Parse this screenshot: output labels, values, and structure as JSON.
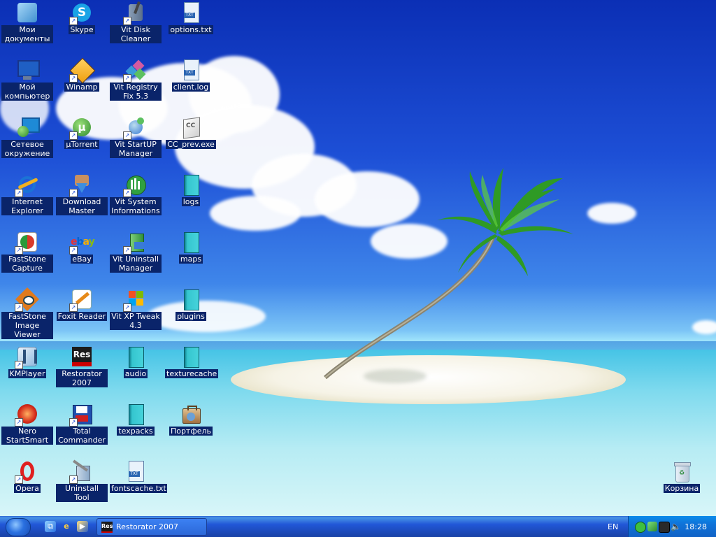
{
  "desktop": {
    "icons": [
      {
        "label": "Мои документы",
        "icon": "my-documents-icon",
        "color": "#4fa3d8"
      },
      {
        "label": "Мой компьютер",
        "icon": "my-computer-icon",
        "color": "#1f5fc4"
      },
      {
        "label": "Сетевое окружение",
        "icon": "network-icon",
        "color": "#1e8ad6"
      },
      {
        "label": "Internet Explorer",
        "icon": "internet-explorer-icon",
        "color": "#1b73d6"
      },
      {
        "label": "FastStone Capture",
        "icon": "faststone-capture-icon",
        "color": "#d83a2a"
      },
      {
        "label": "FastStone Image Viewer",
        "icon": "faststone-image-viewer-icon",
        "color": "#e07a1c"
      },
      {
        "label": "KMPlayer",
        "icon": "kmplayer-icon",
        "color": "#8fb9de"
      },
      {
        "label": "Nero StartSmart",
        "icon": "nero-icon",
        "color": "#d42a1a"
      },
      {
        "label": "Opera",
        "icon": "opera-icon",
        "color": "#e02020"
      },
      {
        "label": "Skype",
        "icon": "skype-icon",
        "color": "#1aa3e6"
      },
      {
        "label": "Winamp",
        "icon": "winamp-icon",
        "color": "#f0a010"
      },
      {
        "label": "µTorrent",
        "icon": "utorrent-icon",
        "color": "#4aa83a"
      },
      {
        "label": "Download Master",
        "icon": "download-master-icon",
        "color": "#3d8ee0"
      },
      {
        "label": "eBay",
        "icon": "ebay-icon",
        "color": "#e53238"
      },
      {
        "label": "Foxit Reader",
        "icon": "foxit-reader-icon",
        "color": "#e68a1a"
      },
      {
        "label": "Restorator 2007",
        "icon": "restorator-icon",
        "color": "#1b1b1b"
      },
      {
        "label": "Total Commander",
        "icon": "total-commander-icon",
        "color": "#2050b0"
      },
      {
        "label": "Uninstall Tool",
        "icon": "uninstall-tool-icon",
        "color": "#8aa8c8"
      },
      {
        "label": "Vit Disk Cleaner",
        "icon": "vit-disk-cleaner-icon",
        "color": "#5b6f8a"
      },
      {
        "label": "Vit Registry Fix 5.3",
        "icon": "vit-registry-fix-icon",
        "color": "#d45aa0"
      },
      {
        "label": "Vit StartUP Manager",
        "icon": "vit-startup-manager-icon",
        "color": "#3a7bd5"
      },
      {
        "label": "Vit System Informations",
        "icon": "vit-system-info-icon",
        "color": "#30a040"
      },
      {
        "label": "Vit Uninstall Manager",
        "icon": "vit-uninstall-manager-icon",
        "color": "#2f8f3a"
      },
      {
        "label": "Vit XP Tweak 4.3",
        "icon": "vit-xp-tweak-icon",
        "color": "#f28c1a"
      },
      {
        "label": "audio",
        "icon": "folder-icon",
        "color": "#35c6cf"
      },
      {
        "label": "texpacks",
        "icon": "folder-icon",
        "color": "#35c6cf"
      },
      {
        "label": "fontscache.txt",
        "icon": "text-file-icon",
        "color": "#2a65b2"
      },
      {
        "label": "options.txt",
        "icon": "text-file-icon",
        "color": "#2a65b2"
      },
      {
        "label": "client.log",
        "icon": "text-file-icon",
        "color": "#2a65b2"
      },
      {
        "label": "CC_prev.exe",
        "icon": "exe-file-icon",
        "color": "#dddddd"
      },
      {
        "label": "logs",
        "icon": "folder-icon",
        "color": "#35c6cf"
      },
      {
        "label": "maps",
        "icon": "folder-icon",
        "color": "#35c6cf"
      },
      {
        "label": "plugins",
        "icon": "folder-icon",
        "color": "#35c6cf"
      },
      {
        "label": "texturecache",
        "icon": "folder-icon",
        "color": "#35c6cf"
      },
      {
        "label": "Портфель",
        "icon": "briefcase-icon",
        "color": "#c8a070"
      },
      {
        "label": "Корзина",
        "icon": "recycle-bin-icon",
        "color": "#b8c8d8"
      }
    ]
  },
  "taskbar": {
    "start_icon": "start-button-icon",
    "quick_launch": [
      "show-desktop-icon",
      "internet-explorer-icon",
      "media-player-icon"
    ],
    "task_button_label": "Restorator 2007",
    "task_button_icon_text": "Res",
    "language": "EN",
    "clock": "18:28",
    "tray_icons": [
      "network-tray-icon",
      "safely-remove-tray-icon",
      "antivirus-tray-icon",
      "volume-tray-icon"
    ]
  },
  "colors": {
    "selection_label_bg": "#0a246a",
    "taskbar_blue": "#2157d7",
    "tray_blue": "#0f72d8"
  }
}
